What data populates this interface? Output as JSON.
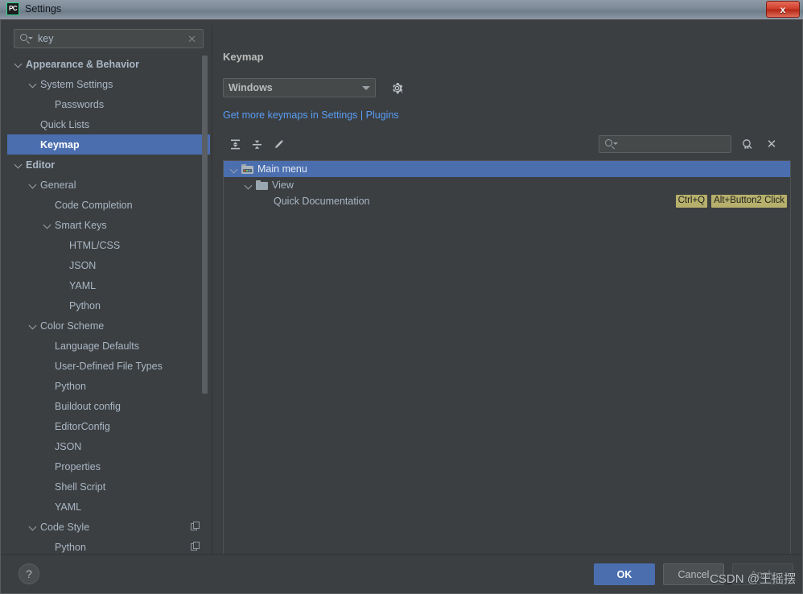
{
  "window": {
    "title": "Settings",
    "app_icon": "pycharm-icon",
    "close_label": "x"
  },
  "sidebar": {
    "search": {
      "value": "key",
      "placeholder": "",
      "search_icon": "search-icon",
      "clear_icon": "clear-icon"
    },
    "items": [
      {
        "label": "Appearance & Behavior",
        "indent": 0,
        "expanded": true,
        "bold": true,
        "selected": false,
        "copy_icon": false
      },
      {
        "label": "System Settings",
        "indent": 1,
        "expanded": true,
        "bold": false,
        "selected": false,
        "copy_icon": false
      },
      {
        "label": "Passwords",
        "indent": 2,
        "expanded": null,
        "bold": false,
        "selected": false,
        "copy_icon": false
      },
      {
        "label": "Quick Lists",
        "indent": 1,
        "expanded": null,
        "bold": false,
        "selected": false,
        "copy_icon": false
      },
      {
        "label": "Keymap",
        "indent": 1,
        "expanded": null,
        "bold": true,
        "selected": true,
        "copy_icon": false
      },
      {
        "label": "Editor",
        "indent": 0,
        "expanded": true,
        "bold": true,
        "selected": false,
        "copy_icon": false
      },
      {
        "label": "General",
        "indent": 1,
        "expanded": true,
        "bold": false,
        "selected": false,
        "copy_icon": false
      },
      {
        "label": "Code Completion",
        "indent": 2,
        "expanded": null,
        "bold": false,
        "selected": false,
        "copy_icon": false
      },
      {
        "label": "Smart Keys",
        "indent": 2,
        "expanded": true,
        "bold": false,
        "selected": false,
        "copy_icon": false
      },
      {
        "label": "HTML/CSS",
        "indent": 3,
        "expanded": null,
        "bold": false,
        "selected": false,
        "copy_icon": false
      },
      {
        "label": "JSON",
        "indent": 3,
        "expanded": null,
        "bold": false,
        "selected": false,
        "copy_icon": false
      },
      {
        "label": "YAML",
        "indent": 3,
        "expanded": null,
        "bold": false,
        "selected": false,
        "copy_icon": false
      },
      {
        "label": "Python",
        "indent": 3,
        "expanded": null,
        "bold": false,
        "selected": false,
        "copy_icon": false
      },
      {
        "label": "Color Scheme",
        "indent": 1,
        "expanded": true,
        "bold": false,
        "selected": false,
        "copy_icon": false
      },
      {
        "label": "Language Defaults",
        "indent": 2,
        "expanded": null,
        "bold": false,
        "selected": false,
        "copy_icon": false
      },
      {
        "label": "User-Defined File Types",
        "indent": 2,
        "expanded": null,
        "bold": false,
        "selected": false,
        "copy_icon": false
      },
      {
        "label": "Python",
        "indent": 2,
        "expanded": null,
        "bold": false,
        "selected": false,
        "copy_icon": false
      },
      {
        "label": "Buildout config",
        "indent": 2,
        "expanded": null,
        "bold": false,
        "selected": false,
        "copy_icon": false
      },
      {
        "label": "EditorConfig",
        "indent": 2,
        "expanded": null,
        "bold": false,
        "selected": false,
        "copy_icon": false
      },
      {
        "label": "JSON",
        "indent": 2,
        "expanded": null,
        "bold": false,
        "selected": false,
        "copy_icon": false
      },
      {
        "label": "Properties",
        "indent": 2,
        "expanded": null,
        "bold": false,
        "selected": false,
        "copy_icon": false
      },
      {
        "label": "Shell Script",
        "indent": 2,
        "expanded": null,
        "bold": false,
        "selected": false,
        "copy_icon": false
      },
      {
        "label": "YAML",
        "indent": 2,
        "expanded": null,
        "bold": false,
        "selected": false,
        "copy_icon": false
      },
      {
        "label": "Code Style",
        "indent": 1,
        "expanded": true,
        "bold": false,
        "selected": false,
        "copy_icon": true
      },
      {
        "label": "Python",
        "indent": 2,
        "expanded": null,
        "bold": false,
        "selected": false,
        "copy_icon": true
      }
    ]
  },
  "main": {
    "title": "Keymap",
    "keymap_select": {
      "value": "Windows",
      "dropdown_icon": "chevron-down-icon"
    },
    "gear_icon": "gear-icon",
    "plugins_link": {
      "prefix": "Get more keymaps in Settings",
      "separator": "|",
      "suffix": "Plugins"
    },
    "toolbar": {
      "expand_all_icon": "expand-all-icon",
      "collapse_all_icon": "collapse-all-icon",
      "edit_icon": "edit-pencil-icon",
      "search": {
        "value": "",
        "placeholder": "",
        "search_icon": "search-icon"
      },
      "find_by_shortcut_icon": "find-by-shortcut-icon",
      "close_icon": "close-icon"
    },
    "tree": [
      {
        "label": "Main menu",
        "indent": 0,
        "expanded": true,
        "selected": true,
        "icon": "main-menu-folder-icon",
        "shortcuts": []
      },
      {
        "label": "View",
        "indent": 1,
        "expanded": true,
        "selected": false,
        "icon": "folder-icon",
        "shortcuts": []
      },
      {
        "label": "Quick Documentation",
        "indent": 2,
        "expanded": null,
        "selected": false,
        "icon": null,
        "shortcuts": [
          "Ctrl+Q",
          "Alt+Button2 Click"
        ]
      }
    ]
  },
  "footer": {
    "help_label": "?",
    "ok_label": "OK",
    "cancel_label": "Cancel",
    "apply_label": "Apply"
  },
  "watermark": "CSDN @王摇摆",
  "colors": {
    "accent": "#4b6eaf",
    "link": "#589df6",
    "badge": "#b6b06c",
    "panel_bg": "#3c3f41",
    "field_bg": "#45494a",
    "text": "#a9b7c6"
  }
}
